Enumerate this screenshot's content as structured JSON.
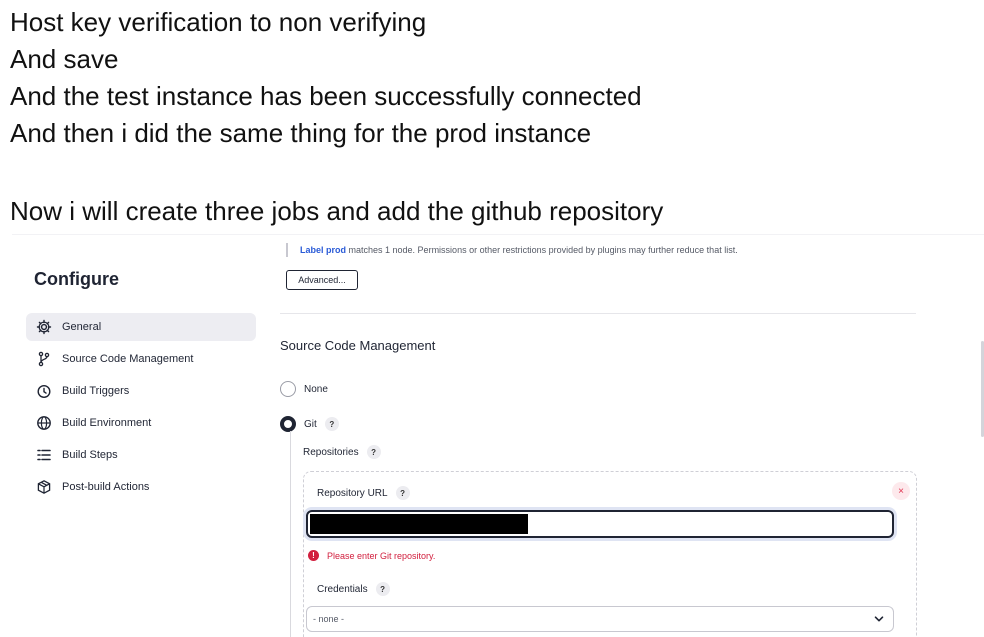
{
  "notes": {
    "lines": [
      "Host key verification to non verifying",
      "And save",
      "And the test instance has been successfully connected",
      "And then i did the same thing for the prod instance"
    ],
    "last": "Now i will create three jobs and add the github repository"
  },
  "sidebar": {
    "title": "Configure",
    "items": [
      {
        "label": "General",
        "icon": "gear-icon",
        "active": true
      },
      {
        "label": "Source Code Management",
        "icon": "branch-icon"
      },
      {
        "label": "Build Triggers",
        "icon": "clock-icon"
      },
      {
        "label": "Build Environment",
        "icon": "globe-icon"
      },
      {
        "label": "Build Steps",
        "icon": "list-icon"
      },
      {
        "label": "Post-build Actions",
        "icon": "package-icon"
      }
    ]
  },
  "main": {
    "label_link": "Label prod",
    "label_text": " matches 1 node. Permissions or other restrictions provided by plugins may further reduce that list.",
    "advanced_button": "Advanced...",
    "scm_title": "Source Code Management",
    "radio_none": "None",
    "radio_git": "Git",
    "help_glyph": "?",
    "repositories_label": "Repositories",
    "repo_url_label": "Repository URL",
    "repo_url_value": "",
    "remove_glyph": "×",
    "error_text": "Please enter Git repository.",
    "error_glyph": "!",
    "credentials_label": "Credentials",
    "credentials_value": "- none -"
  },
  "colors": {
    "error": "#d2203f",
    "link": "#2a5bd7",
    "text_dark": "#1f2433",
    "active_bg": "#ededf2"
  }
}
